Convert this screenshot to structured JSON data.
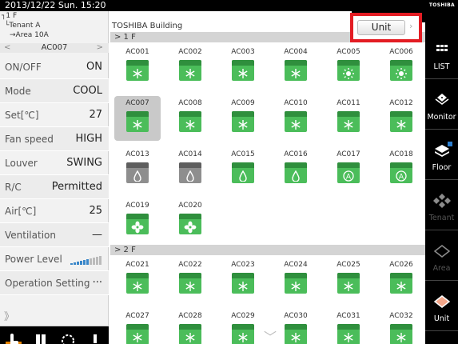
{
  "header": {
    "datetime": "2013/12/22  Sun.  15:20",
    "logo": "TOSHIBA"
  },
  "tree": {
    "floor": "1 F",
    "tenant": "Tenant A",
    "area": "Area 10A"
  },
  "nav": {
    "prev": "<",
    "current": "AC007",
    "next": ">"
  },
  "settings": [
    {
      "label": "ON/OFF",
      "value": "ON"
    },
    {
      "label": "Mode",
      "value": "COOL"
    },
    {
      "label": "Set[℃]",
      "value": "27"
    },
    {
      "label": "Fan speed",
      "value": "HIGH"
    },
    {
      "label": "Louver",
      "value": "SWING"
    },
    {
      "label": "R/C",
      "value": "Permitted"
    },
    {
      "label": "Air[℃]",
      "value": "25"
    },
    {
      "label": "Ventilation",
      "value": "—"
    },
    {
      "label": "Power Level",
      "value": ""
    },
    {
      "label": "Operation Setting",
      "value": "···"
    }
  ],
  "more": "》",
  "building": {
    "name": "TOSHIBA Building"
  },
  "unit_button": {
    "label": "Unit"
  },
  "floors": [
    {
      "label": "> 1 F",
      "units": [
        {
          "name": "AC001",
          "color": "green",
          "mode": "cool"
        },
        {
          "name": "AC002",
          "color": "green",
          "mode": "cool"
        },
        {
          "name": "AC003",
          "color": "green",
          "mode": "cool"
        },
        {
          "name": "AC004",
          "color": "green",
          "mode": "cool"
        },
        {
          "name": "AC005",
          "color": "green",
          "mode": "heat"
        },
        {
          "name": "AC006",
          "color": "green",
          "mode": "heat"
        },
        {
          "name": "AC007",
          "color": "green",
          "mode": "cool",
          "selected": true
        },
        {
          "name": "AC008",
          "color": "green",
          "mode": "cool"
        },
        {
          "name": "AC009",
          "color": "green",
          "mode": "cool"
        },
        {
          "name": "AC010",
          "color": "green",
          "mode": "cool"
        },
        {
          "name": "AC011",
          "color": "green",
          "mode": "cool"
        },
        {
          "name": "AC012",
          "color": "green",
          "mode": "cool"
        },
        {
          "name": "AC013",
          "color": "gray",
          "mode": "dry"
        },
        {
          "name": "AC014",
          "color": "gray",
          "mode": "dry"
        },
        {
          "name": "AC015",
          "color": "green",
          "mode": "dry"
        },
        {
          "name": "AC016",
          "color": "green",
          "mode": "dry"
        },
        {
          "name": "AC017",
          "color": "green",
          "mode": "auto"
        },
        {
          "name": "AC018",
          "color": "green",
          "mode": "auto"
        },
        {
          "name": "AC019",
          "color": "green",
          "mode": "fan"
        },
        {
          "name": "AC020",
          "color": "green",
          "mode": "fan"
        }
      ]
    },
    {
      "label": "> 2 F",
      "units": [
        {
          "name": "AC021",
          "color": "green",
          "mode": "cool"
        },
        {
          "name": "AC022",
          "color": "green",
          "mode": "cool"
        },
        {
          "name": "AC023",
          "color": "green",
          "mode": "cool"
        },
        {
          "name": "AC024",
          "color": "green",
          "mode": "cool"
        },
        {
          "name": "AC025",
          "color": "green",
          "mode": "cool"
        },
        {
          "name": "AC026",
          "color": "green",
          "mode": "cool"
        },
        {
          "name": "AC027",
          "color": "green",
          "mode": "cool"
        },
        {
          "name": "AC028",
          "color": "green",
          "mode": "cool"
        },
        {
          "name": "AC029",
          "color": "green",
          "mode": "cool"
        },
        {
          "name": "AC030",
          "color": "green",
          "mode": "cool"
        },
        {
          "name": "AC031",
          "color": "green",
          "mode": "cool"
        },
        {
          "name": "AC032",
          "color": "green",
          "mode": "cool"
        }
      ]
    }
  ],
  "right_menu": [
    {
      "label": "LIST",
      "icon": "list-icon",
      "enabled": true
    },
    {
      "label": "Monitor",
      "icon": "monitor-icon",
      "enabled": true
    },
    {
      "label": "Floor",
      "icon": "floor-icon",
      "enabled": true
    },
    {
      "label": "Tenant",
      "icon": "tenant-icon",
      "enabled": false
    },
    {
      "label": "Area",
      "icon": "area-icon",
      "enabled": false
    },
    {
      "label": "Unit",
      "icon": "unit-icon",
      "enabled": true
    }
  ],
  "colors": {
    "unit_green": "#4bbd5a",
    "unit_gray": "#8e8e8e",
    "highlight": "#e31c23"
  }
}
